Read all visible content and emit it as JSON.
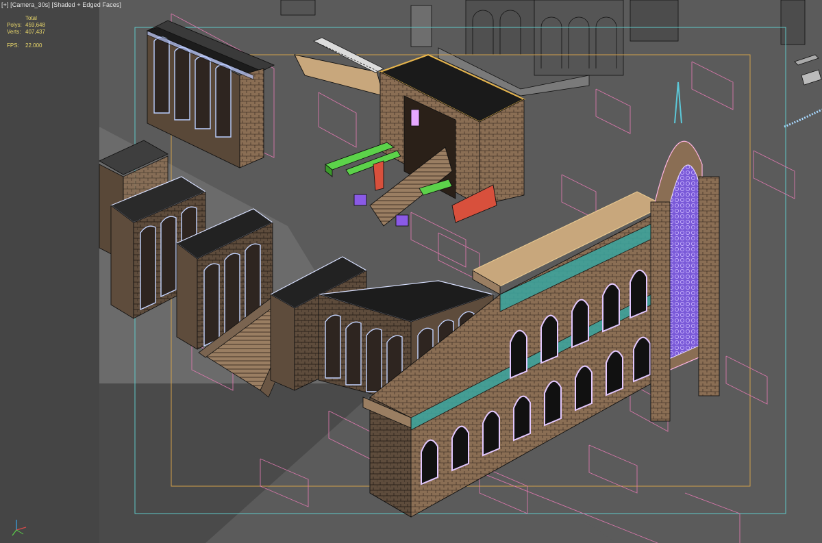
{
  "viewport": {
    "label_parts": {
      "menu": "[+]",
      "camera": "[Camera_30s]",
      "shading": "[Shaded + Edged Faces]"
    },
    "stats": {
      "header": "Total",
      "polys_label": "Polys:",
      "polys_value": "459,648",
      "verts_label": "Verts:",
      "verts_value": "407,437",
      "fps_label": "FPS:",
      "fps_value": "22.000"
    }
  },
  "colors": {
    "viewport_bg": "#5b5b5b",
    "panel_bg": "#454545",
    "stats_text": "#e8d66a",
    "label_text": "#e6e6e6",
    "safe_frame_cyan": "#5fc8c8",
    "safe_frame_orange": "#d2a04b",
    "bbox_pink": "#e67ab4",
    "stone": "#8a6e54",
    "wireframe": "#111111",
    "selected_green": "#5cd24a",
    "selected_purple": "#8a5ae6",
    "selected_red": "#d8503c",
    "teal_frieze": "#3aa6a0"
  },
  "gizmo": {
    "icon": "axis-gizmo-icon"
  }
}
